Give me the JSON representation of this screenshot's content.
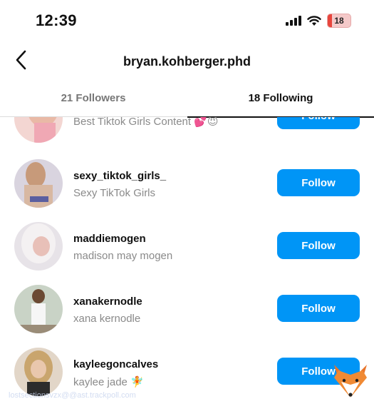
{
  "status_bar": {
    "time": "12:39",
    "battery": "18",
    "battery_level": 0.18
  },
  "header": {
    "title": "bryan.kohberger.phd",
    "back_icon": "chevron-left-icon"
  },
  "tabs": [
    {
      "label": "21 Followers",
      "active": false
    },
    {
      "label": "18 Following",
      "active": true
    }
  ],
  "accounts": [
    {
      "username": "",
      "full_name": "Best Tiktok Girls Content 💕😈",
      "button": "Follow"
    },
    {
      "username": "sexy_tiktok_girls_",
      "full_name": "Sexy TikTok Girls",
      "button": "Follow"
    },
    {
      "username": "maddiemogen",
      "full_name": "madison may mogen",
      "button": "Follow"
    },
    {
      "username": "xanakernodle",
      "full_name": "xana kernodle",
      "button": "Follow"
    },
    {
      "username": "kayleegoncalves",
      "full_name": "kaylee jade 🧚",
      "button": "Follow"
    }
  ],
  "watermark": "lostsectionsvzx@@ast.trackpoll.com",
  "colors": {
    "accent": "#0095f6",
    "battery_low": "#e8453c"
  }
}
